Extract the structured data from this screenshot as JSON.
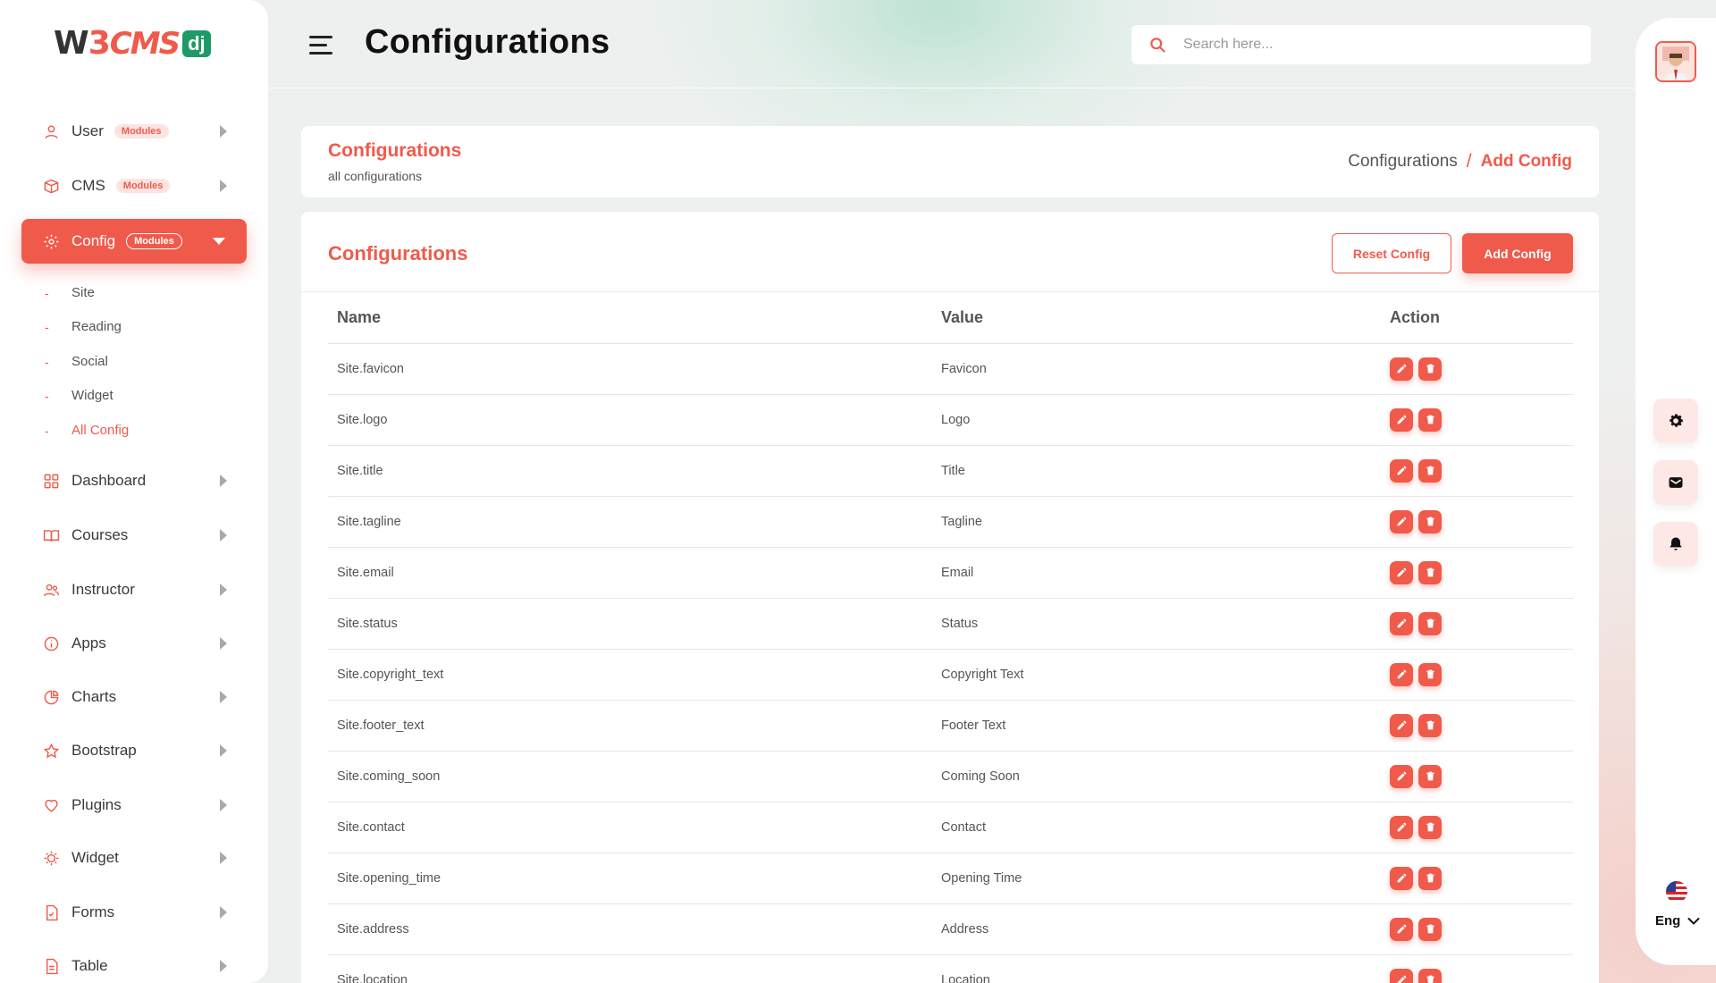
{
  "brand": {
    "w": "W",
    "three": "3",
    "cms": "CMS",
    "dj": "dj"
  },
  "sidebar": {
    "items": [
      {
        "label": "User",
        "badge": "Modules",
        "icon": "user-icon"
      },
      {
        "label": "CMS",
        "badge": "Modules",
        "icon": "box-icon"
      },
      {
        "label": "Config",
        "badge": "Modules",
        "icon": "gear-icon",
        "active": true
      },
      {
        "label": "Dashboard",
        "icon": "grid-icon"
      },
      {
        "label": "Courses",
        "icon": "book-icon"
      },
      {
        "label": "Instructor",
        "icon": "users-icon"
      },
      {
        "label": "Apps",
        "icon": "info-icon"
      },
      {
        "label": "Charts",
        "icon": "pie-chart-icon"
      },
      {
        "label": "Bootstrap",
        "icon": "star-icon"
      },
      {
        "label": "Plugins",
        "icon": "heart-icon"
      },
      {
        "label": "Widget",
        "icon": "sun-icon"
      },
      {
        "label": "Forms",
        "icon": "file-check-icon"
      },
      {
        "label": "Table",
        "icon": "document-icon"
      }
    ],
    "config_sub": [
      "Site",
      "Reading",
      "Social",
      "Widget",
      "All Config"
    ],
    "config_sub_current": "All Config"
  },
  "header": {
    "title": "Configurations",
    "search_placeholder": "Search here..."
  },
  "breadcrumb_card": {
    "title": "Configurations",
    "subtitle": "all configurations",
    "crumb_parent": "Configurations",
    "crumb_separator": "/",
    "crumb_current": "Add Config"
  },
  "main": {
    "title": "Configurations",
    "reset_label": "Reset Config",
    "add_label": "Add Config",
    "columns": [
      "Name",
      "Value",
      "Action"
    ],
    "rows": [
      {
        "name": "Site.favicon",
        "value": "Favicon"
      },
      {
        "name": "Site.logo",
        "value": "Logo"
      },
      {
        "name": "Site.title",
        "value": "Title"
      },
      {
        "name": "Site.tagline",
        "value": "Tagline"
      },
      {
        "name": "Site.email",
        "value": "Email"
      },
      {
        "name": "Site.status",
        "value": "Status"
      },
      {
        "name": "Site.copyright_text",
        "value": "Copyright Text"
      },
      {
        "name": "Site.footer_text",
        "value": "Footer Text"
      },
      {
        "name": "Site.coming_soon",
        "value": "Coming Soon"
      },
      {
        "name": "Site.contact",
        "value": "Contact"
      },
      {
        "name": "Site.opening_time",
        "value": "Opening Time"
      },
      {
        "name": "Site.address",
        "value": "Address"
      },
      {
        "name": "Site.location",
        "value": "Location"
      }
    ]
  },
  "rail": {
    "language": "Eng",
    "buttons": [
      "gear-icon",
      "mail-icon",
      "bell-icon"
    ]
  },
  "colors": {
    "accent": "#f05a4b",
    "accent_soft": "#fde8e5",
    "brand_green": "#1d9a66"
  }
}
